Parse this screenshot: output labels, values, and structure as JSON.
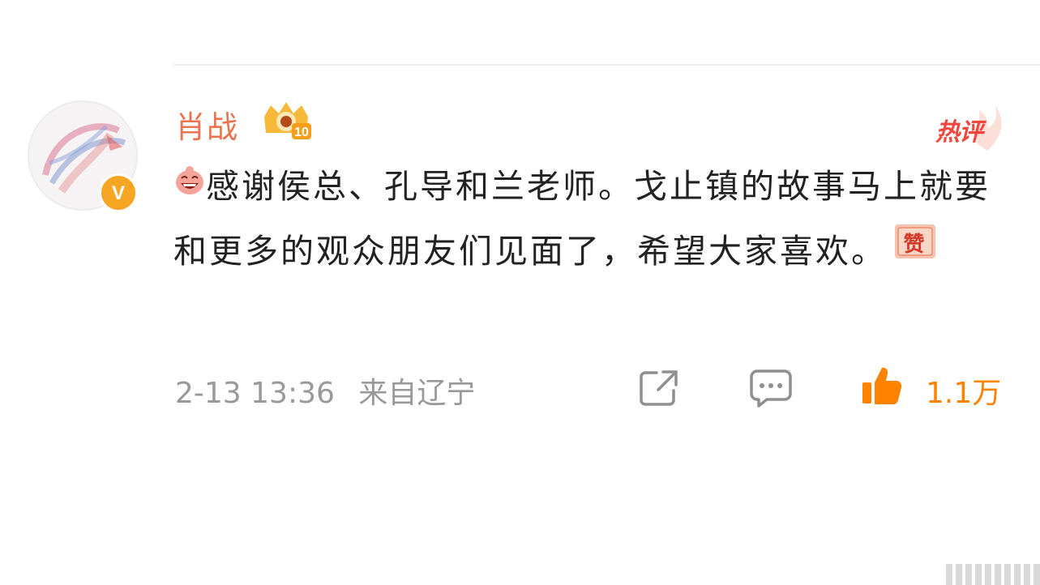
{
  "comment": {
    "username": "肖战",
    "hot_badge": "热评",
    "content_part1": "感谢侯总、孔导和兰老师。戈止镇的故事马上就要和更多的观众朋友们见面了，希望大家喜欢。",
    "praise_emoji_text": "赞",
    "badge_level": "10",
    "verified_mark": "V",
    "timestamp": "2-13 13:36",
    "location": "来自辽宁",
    "like_count": "1.1万"
  },
  "colors": {
    "username": "#eb7350",
    "hot_badge": "#f1463e",
    "like": "#ff8200",
    "meta": "#999999"
  },
  "icons": {
    "badge": "crown-level-icon",
    "verified": "verified-v-icon",
    "share": "share-icon",
    "comment": "comment-icon",
    "like": "thumbs-up-icon"
  }
}
